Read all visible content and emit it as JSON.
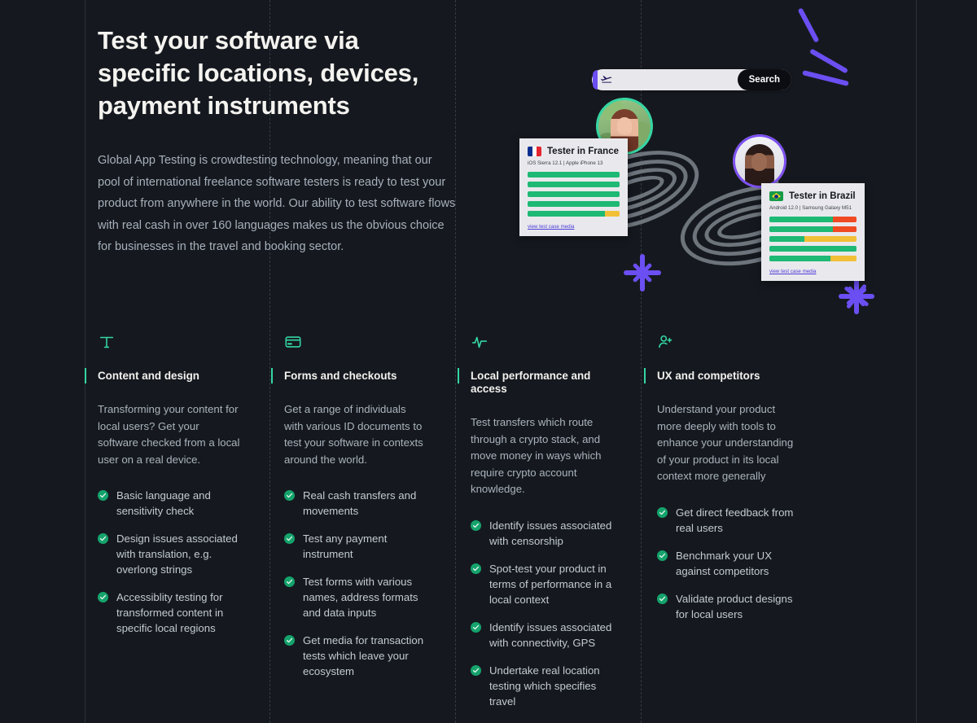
{
  "theme": {
    "bg": "#15191f",
    "accent_teal": "#35d6a4",
    "accent_purple": "#6b4ff2",
    "heading_color": "#f4f3ef",
    "body_color": "#a7b0bb",
    "bar_green": "#1eb974",
    "bar_yellow": "#f2c037",
    "bar_red": "#f04a23"
  },
  "hero": {
    "title": "Test your software via specific locations, devices, payment instruments",
    "body": "Global App Testing is crowdtesting technology, meaning that our pool of international freelance software testers is ready to test your product from anywhere in the world. Our ability to test software flows with real cash in over 160 languages makes us the obvious choice for businesses in the travel and booking sector."
  },
  "illustration": {
    "search": {
      "placeholder": "",
      "value": "",
      "plane_icon": "airplane-icon",
      "button_label": "Search"
    },
    "avatars": [
      {
        "name": "tester-avatar-france",
        "ring": "#35d6a4"
      },
      {
        "name": "tester-avatar-brazil",
        "ring": "#7d4ff2"
      }
    ],
    "cards": [
      {
        "name": "tester-card-france",
        "flag": "flag-france-icon",
        "title": "Tester in France",
        "meta": "iOS Sierra 12.1 | Apple iPhone 13",
        "link": "view test case media",
        "bars": [
          [
            {
              "color": "#1eb974",
              "pct": 100
            }
          ],
          [
            {
              "color": "#1eb974",
              "pct": 100
            }
          ],
          [
            {
              "color": "#1eb974",
              "pct": 100
            }
          ],
          [
            {
              "color": "#1eb974",
              "pct": 100
            }
          ],
          [
            {
              "color": "#1eb974",
              "pct": 84
            },
            {
              "color": "#f2c037",
              "pct": 16
            }
          ]
        ]
      },
      {
        "name": "tester-card-brazil",
        "flag": "flag-brazil-icon",
        "title": "Tester in Brazil",
        "meta": "Android 12.0 | Samsung Galaxy M51",
        "link": "view test case media",
        "bars": [
          [
            {
              "color": "#1eb974",
              "pct": 73
            },
            {
              "color": "#f04a23",
              "pct": 27
            }
          ],
          [
            {
              "color": "#1eb974",
              "pct": 73
            },
            {
              "color": "#f04a23",
              "pct": 27
            }
          ],
          [
            {
              "color": "#1eb974",
              "pct": 40
            },
            {
              "color": "#f2c037",
              "pct": 60
            }
          ],
          [
            {
              "color": "#1eb974",
              "pct": 100
            }
          ],
          [
            {
              "color": "#1eb974",
              "pct": 70
            },
            {
              "color": "#f2c037",
              "pct": 30
            }
          ]
        ]
      }
    ]
  },
  "columns": [
    {
      "icon": "text-type-icon",
      "title": "Content and design",
      "blurb": "Transforming your content for local users? Get your software checked from a local user on a real device.",
      "items": [
        "Basic language and sensitivity check",
        "Design issues associated with translation, e.g. overlong strings",
        "Accessiblity testing for transformed content in specific local regions"
      ]
    },
    {
      "icon": "credit-card-icon",
      "title": "Forms and checkouts",
      "blurb": "Get a range of individuals with various ID documents to test your software in contexts around the world.",
      "items": [
        "Real cash transfers and movements",
        "Test any payment instrument",
        "Test forms with various names, address formats and data inputs",
        "Get media for transaction tests which leave your ecosystem"
      ]
    },
    {
      "icon": "activity-pulse-icon",
      "title": "Local performance and access",
      "blurb": "Test transfers which route through a crypto stack, and move money in ways which require crypto account knowledge.",
      "items": [
        "Identify issues associated with censorship",
        "Spot-test your product in terms of performance in a local context",
        "Identify issues associated with connectivity, GPS",
        "Undertake real location testing which specifies travel"
      ]
    },
    {
      "icon": "user-plus-icon",
      "title": "UX and competitors",
      "blurb": "Understand your product more deeply with tools to enhance your understanding of your product in its local context more generally",
      "items": [
        "Get direct feedback from real users",
        "Benchmark your UX against competitors",
        "Validate product designs for local users"
      ]
    }
  ]
}
